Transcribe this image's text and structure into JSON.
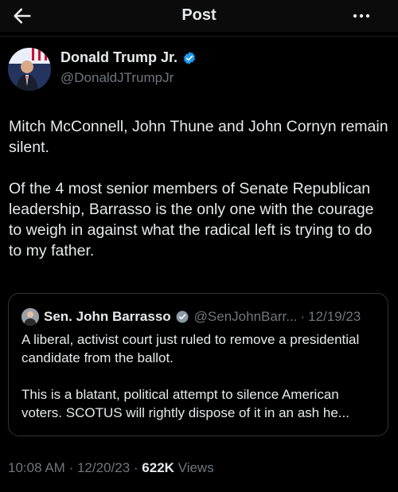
{
  "header": {
    "title": "Post"
  },
  "author": {
    "name": "Donald Trump Jr.",
    "handle": "@DonaldJTrumpJr"
  },
  "post": {
    "paragraphs": [
      "Mitch McConnell, John Thune and John Cornyn remain silent.",
      "Of the 4 most senior members of Senate Republican leadership, Barrasso is the only one with the courage to weigh in against what the radical left is trying to do to my father."
    ]
  },
  "quote": {
    "name": "Sen. John Barrasso",
    "handle": "@SenJohnBarr...",
    "separator": "·",
    "date": "12/19/23",
    "paragraphs": [
      "A liberal, activist court just ruled to remove a presidential candidate from the ballot.",
      "This is a blatant, political attempt to silence American voters. SCOTUS will rightly dispose of it in an ash he..."
    ]
  },
  "meta": {
    "time": "10:08 AM",
    "separator": "·",
    "date": "12/20/23",
    "views_count": "622K",
    "views_label": "Views"
  },
  "icons": {
    "back": "arrow-left-icon",
    "more": "more-horizontal-icon",
    "verified": "verified-badge-icon"
  },
  "colors": {
    "background": "#000000",
    "text": "#e7e9ea",
    "secondary_text": "#71767b",
    "verified_blue": "#1d9bf0",
    "border": "#2f3336"
  }
}
